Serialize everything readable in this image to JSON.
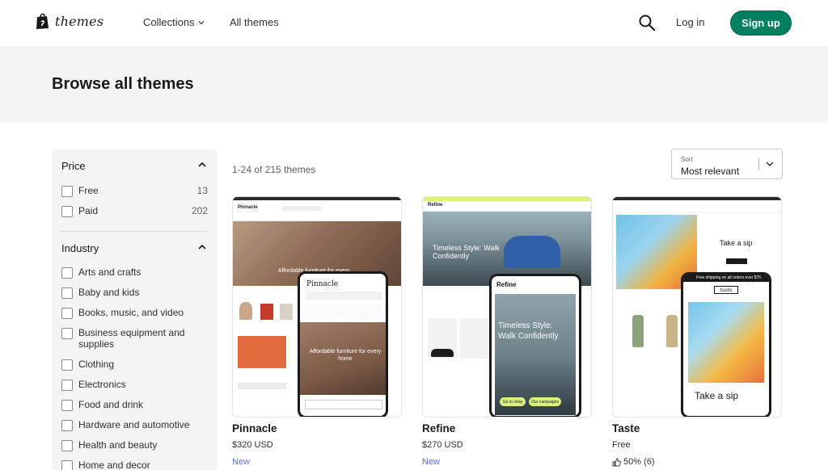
{
  "nav": {
    "logo_text": "themes",
    "collections_label": "Collections",
    "all_themes_label": "All themes",
    "login_label": "Log in",
    "signup_label": "Sign up",
    "brand_color": "#008060"
  },
  "hero": {
    "title": "Browse all themes"
  },
  "filters": {
    "price": {
      "title": "Price",
      "items": [
        {
          "label": "Free",
          "count": "13"
        },
        {
          "label": "Paid",
          "count": "202"
        }
      ]
    },
    "industry": {
      "title": "Industry",
      "items": [
        {
          "label": "Arts and crafts"
        },
        {
          "label": "Baby and kids"
        },
        {
          "label": "Books, music, and video"
        },
        {
          "label": "Business equipment and supplies"
        },
        {
          "label": "Clothing"
        },
        {
          "label": "Electronics"
        },
        {
          "label": "Food and drink"
        },
        {
          "label": "Hardware and automotive"
        },
        {
          "label": "Health and beauty"
        },
        {
          "label": "Home and decor"
        }
      ]
    }
  },
  "results": {
    "count_text": "1-24 of 215 themes"
  },
  "sort": {
    "label": "Sort",
    "value": "Most relevant"
  },
  "themes": [
    {
      "name": "Pinnacle",
      "price": "$320 USD",
      "tag": "New",
      "preview": {
        "site_name": "Pinnacle",
        "hero_text": "Affordable furniture for every home"
      }
    },
    {
      "name": "Refine",
      "price": "$270 USD",
      "tag": "New",
      "preview": {
        "site_name": "Refine",
        "hero_text": "Timeless Style: Walk Confidently",
        "btn_shop": "Go to shop",
        "btn_campaigns": "Our campaigns"
      }
    },
    {
      "name": "Taste",
      "price": "Free",
      "rating": "50% (6)",
      "preview": {
        "banner": "Free shipping on all orders over $75",
        "logo": "taste",
        "hero_text": "Take a sip",
        "desktop_text": "Take a sip"
      }
    }
  ],
  "tag_color": "#5a73d6"
}
